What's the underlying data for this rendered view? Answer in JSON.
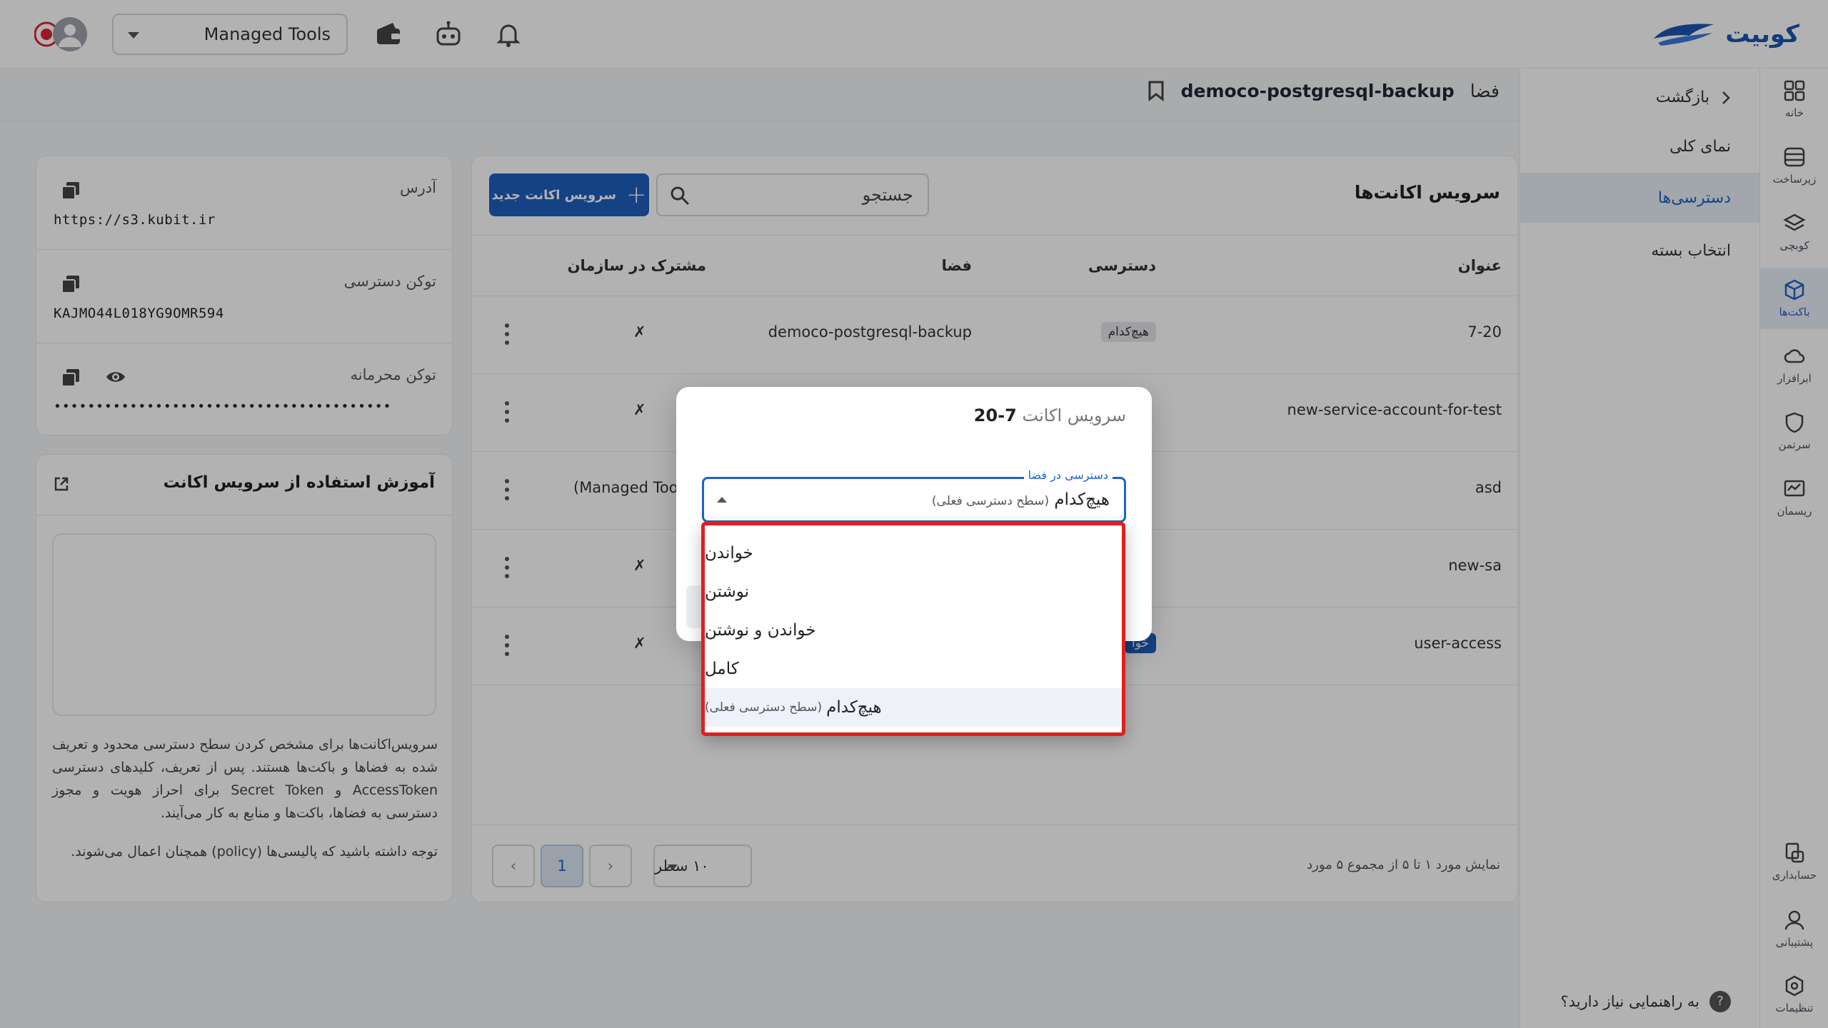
{
  "brand": {
    "name": "کوبیت"
  },
  "topbar": {
    "workspace_value": "Managed Tools"
  },
  "rail": [
    {
      "label": "خانه",
      "icon": "grid-icon"
    },
    {
      "label": "زیرساخت",
      "icon": "server-icon"
    },
    {
      "label": "کوبچی",
      "icon": "layers-icon"
    },
    {
      "label": "باکت‌ها",
      "icon": "cube-icon",
      "active": true
    },
    {
      "label": "ابرافزار",
      "icon": "cloud-icon"
    },
    {
      "label": "سرتمن",
      "icon": "shield-icon"
    },
    {
      "label": "ریسمان",
      "icon": "monitor-icon"
    },
    {
      "label": "حسابداری",
      "icon": "billing-icon"
    },
    {
      "label": "پشتیبانی",
      "icon": "support-icon"
    },
    {
      "label": "تنظیمات",
      "icon": "settings-icon"
    }
  ],
  "subnav": {
    "back": "بازگشت",
    "items": [
      "نمای کلی",
      "دسترسی‌ها",
      "انتخاب بسته"
    ],
    "help": "به راهنمایی نیاز دارید؟",
    "help_icon": "?"
  },
  "page": {
    "label": "فضا",
    "name": "democo-postgresql-backup"
  },
  "accounts": {
    "title": "سرویس اکانت‌ها",
    "search_placeholder": "جستجو",
    "new_button": "سرویس اکانت جدید",
    "columns": {
      "title": "عنوان",
      "access": "دسترسی",
      "space": "فضا",
      "shared": "مشترک در سازمان"
    },
    "rows": [
      {
        "title": "7-20",
        "access": "هیچ‌کدام",
        "space": "democo-postgresql-backup",
        "shared": "✗"
      },
      {
        "title": "new-service-account-for-test",
        "access": "",
        "space": "",
        "shared": "✗"
      },
      {
        "title": "asd",
        "access": "",
        "space": "",
        "shared": "(Managed Tools)"
      },
      {
        "title": "new-sa",
        "access": "",
        "space": "",
        "shared": "✗"
      },
      {
        "title": "user-access",
        "access": "خوا",
        "space": "",
        "shared": "✗"
      }
    ],
    "pagination": {
      "summary": "نمایش مورد ۱ تا ۵ از مجموع ۵ مورد",
      "rows_per_page": "۱۰ سطر",
      "current_page": "1",
      "prev": "‹",
      "next": "›"
    }
  },
  "credentials": {
    "address_label": "آدرس",
    "address_value": "https://s3.kubit.ir",
    "access_label": "توکن دسترسی",
    "access_value": "KAJMO44L018YG9OMR594",
    "secret_label": "توکن محرمانه",
    "secret_value": "••••••••••••••••••••••••••••••••••••••••"
  },
  "guide": {
    "title": "آموزش استفاده از سرویس اکانت",
    "paragraph1": "سرویس‌اکانت‌ها برای مشخص کردن سطح دسترسی محدود و تعریف شده به فضاها و باکت‌ها هستند. پس از تعریف، کلیدهای دسترسی AccessToken و Secret Token برای احراز هویت و مجوز دسترسی به فضاها، باکت‌ها و منابع به کار می‌آیند.",
    "paragraph2": "توجه داشته باشید که پالیسی‌ها (policy) همچنان اعمال می‌شوند."
  },
  "dialog": {
    "title_prefix": "سرویس اکانت",
    "title_name": "7-20",
    "field_label": "دسترسی در فضا",
    "field_value": "هیچ‌کدام",
    "field_note": "(سطح دسترسی فعلی)",
    "options": [
      {
        "label": "خواندن",
        "note": ""
      },
      {
        "label": "نوشتن",
        "note": ""
      },
      {
        "label": "خواندن و نوشتن",
        "note": ""
      },
      {
        "label": "کامل",
        "note": ""
      },
      {
        "label": "هیچ‌کدام",
        "note": "(سطح دسترسی فعلی)",
        "selected": true
      }
    ]
  },
  "colors": {
    "accent": "#1f5fbf",
    "highlight_border": "#e02020"
  }
}
